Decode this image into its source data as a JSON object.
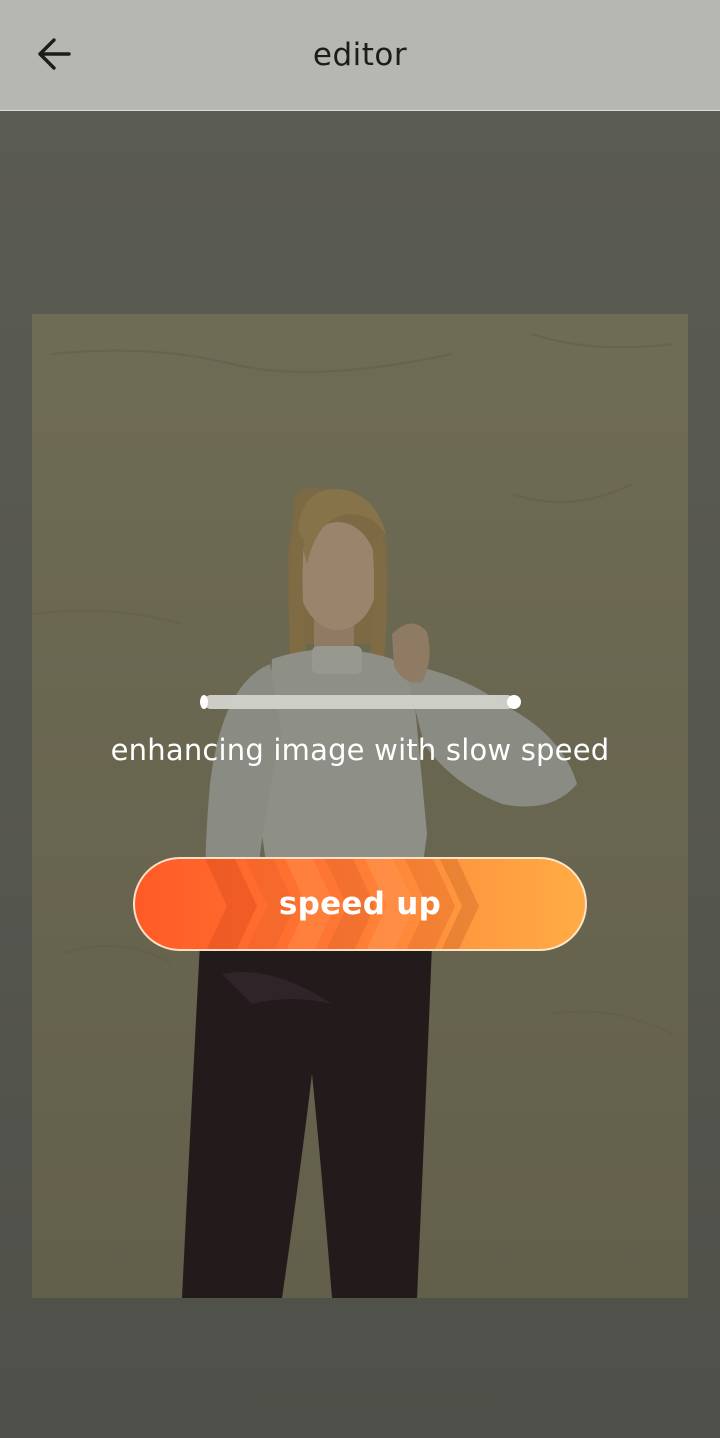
{
  "header": {
    "title": "editor",
    "back_icon": "arrow-left-icon"
  },
  "processing": {
    "progress_fraction": 1.0,
    "status_text": "enhancing image with slow speed"
  },
  "actions": {
    "speed_up_label": "speed up",
    "speed_up_icon": "chevrons-right-icon",
    "gradient_start": "#ff5a26",
    "gradient_end": "#ffac45"
  },
  "colors": {
    "appbar_bg": "#b6b7b0",
    "overlay_bg": "#585950",
    "text_light": "#ffffff"
  }
}
